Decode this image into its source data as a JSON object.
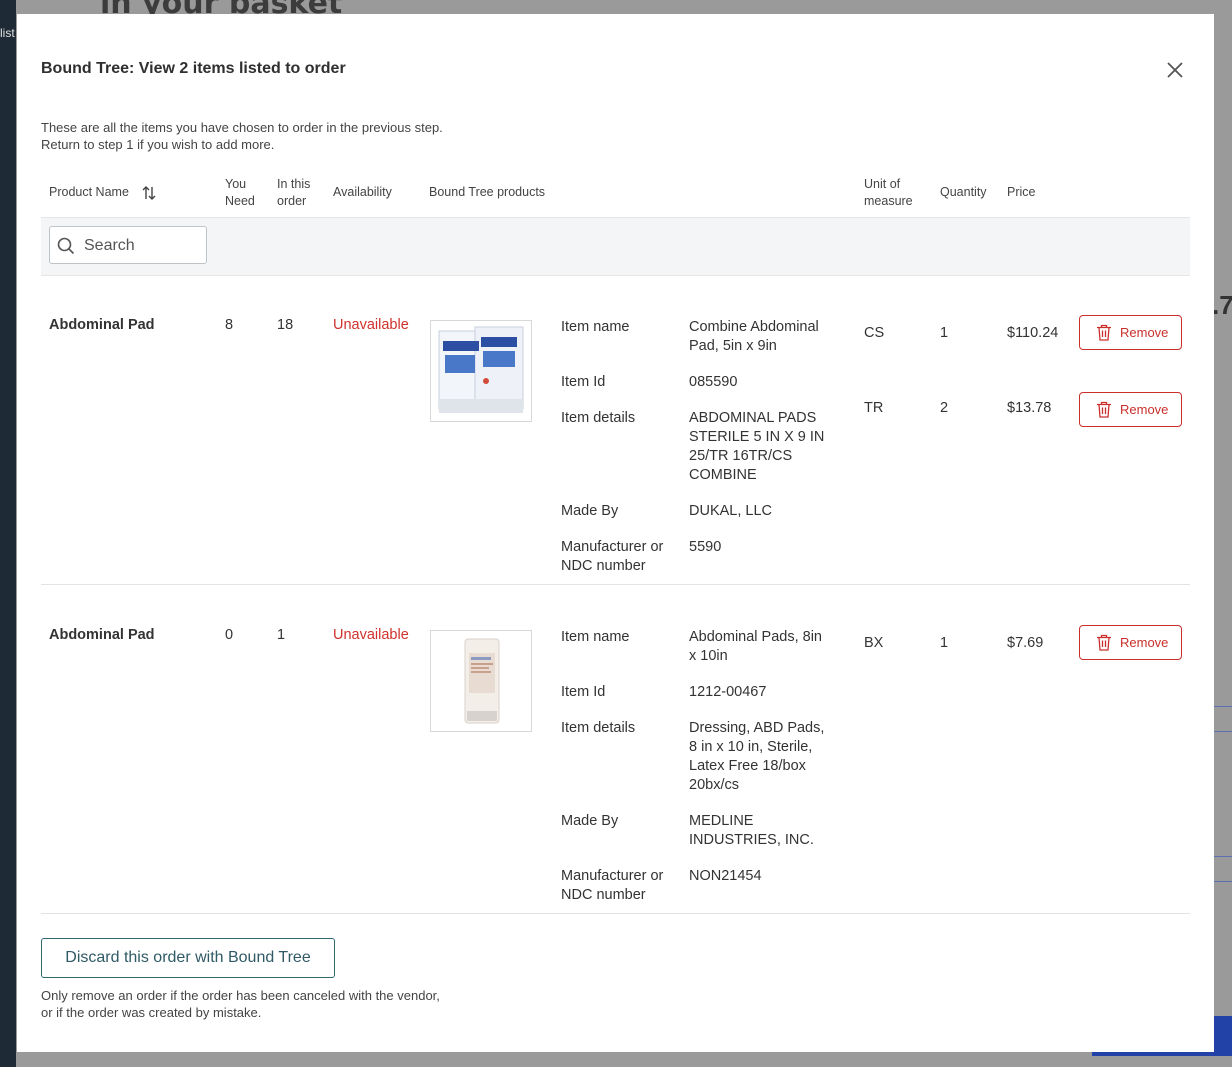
{
  "background": {
    "heading": "in your basket",
    "left_text": "list",
    "right_number": ".7"
  },
  "modal": {
    "title": "Bound Tree: View 2 items listed to order",
    "close_icon": "close-icon",
    "intro_line1": "These are all the items you have chosen to order in the previous step.",
    "intro_line2": "Return to step 1 if you wish to add more.",
    "columns": {
      "product_name": "Product Name",
      "you_need_1": "You",
      "you_need_2": "Need",
      "in_order_1": "In this",
      "in_order_2": "order",
      "availability": "Availability",
      "bt_products": "Bound Tree products",
      "uom_1": "Unit of",
      "uom_2": "measure",
      "quantity": "Quantity",
      "price": "Price"
    },
    "search": {
      "placeholder": "Search"
    },
    "labels": {
      "item_name": "Item name",
      "item_id": "Item Id",
      "item_details": "Item details",
      "made_by": "Made By",
      "mfr_1": "Manufacturer or",
      "mfr_2": "NDC number",
      "remove": "Remove"
    },
    "rows": [
      {
        "product_name": "Abdominal Pad",
        "you_need": "8",
        "in_order": "18",
        "availability": "Unavailable",
        "item_name_1": "Combine Abdominal",
        "item_name_2": "Pad, 5in x 9in",
        "item_id": "085590",
        "details_1": "ABDOMINAL PADS",
        "details_2": "STERILE 5 IN X 9 IN",
        "details_3": "25/TR 16TR/CS",
        "details_4": "COMBINE",
        "made_by_1": "DUKAL, LLC",
        "mfr_number": "5590",
        "units": [
          {
            "uom": "CS",
            "qty": "1",
            "price": "$110.24"
          },
          {
            "uom": "TR",
            "qty": "2",
            "price": "$13.78"
          }
        ]
      },
      {
        "product_name": "Abdominal Pad",
        "you_need": "0",
        "in_order": "1",
        "availability": "Unavailable",
        "item_name_1": "Abdominal Pads, 8in",
        "item_name_2": "x 10in",
        "item_id": "1212-00467",
        "details_1": "Dressing, ABD Pads,",
        "details_2": "8 in x 10 in, Sterile,",
        "details_3": "Latex Free 18/box",
        "details_4": "20bx/cs",
        "made_by_1": "MEDLINE",
        "made_by_2": "INDUSTRIES, INC.",
        "mfr_number": "NON21454",
        "units": [
          {
            "uom": "BX",
            "qty": "1",
            "price": "$7.69"
          }
        ]
      }
    ],
    "discard_label": "Discard this order with Bound Tree",
    "discard_note_1": "Only remove an order if the order has been canceled with the vendor,",
    "discard_note_2": "or if the order was created by mistake.",
    "colors": {
      "danger": "#c9302c",
      "primary_outline": "#2f6a73"
    }
  }
}
